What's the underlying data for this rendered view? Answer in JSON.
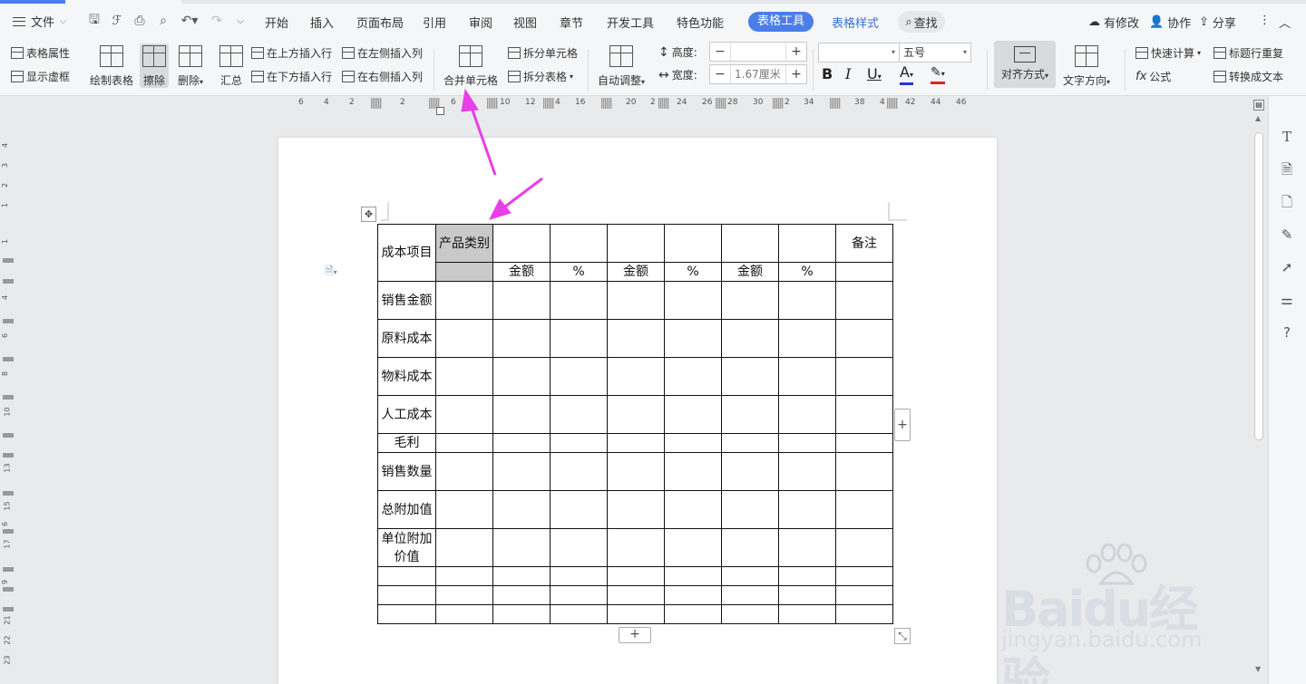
{
  "menubar": {
    "file_label": "文件",
    "items": [
      "开始",
      "插入",
      "页面布局",
      "引用",
      "审阅",
      "视图",
      "章节",
      "开发工具",
      "特色功能"
    ],
    "active_tab": "表格工具",
    "style_tab": "表格样式",
    "search_label": "查找",
    "right": {
      "modified": "有修改",
      "collab": "协作",
      "share": "分享"
    }
  },
  "ribbon": {
    "table_props": "表格属性",
    "show_grid": "显示虚框",
    "draw_table": "绘制表格",
    "erase": "擦除",
    "delete": "删除",
    "summary": "汇总",
    "insert_above": "在上方插入行",
    "insert_below": "在下方插入行",
    "insert_left": "在左侧插入列",
    "insert_right": "在右侧插入列",
    "merge_cells": "合并单元格",
    "split_cells": "拆分单元格",
    "split_table": "拆分表格",
    "auto_adjust": "自动调整",
    "height_label": "高度:",
    "height_value": "",
    "width_label": "宽度:",
    "width_value": "1.67厘米",
    "font_name": "",
    "font_size": "五号",
    "align": "对齐方式",
    "text_direction": "文字方向",
    "quick_calc": "快速计算",
    "formula": "公式",
    "repeat_header": "标题行重复",
    "to_text": "转换成文本"
  },
  "hruler_ticks": [
    "6",
    "4",
    "2",
    "2",
    "6",
    "10",
    "12",
    "4",
    "16",
    "20",
    "2",
    "24",
    "26",
    "28",
    "30",
    "2",
    "34",
    "38",
    "4",
    "42",
    "44",
    "46"
  ],
  "vruler_ticks": [
    "4",
    "3",
    "2",
    "1",
    "1",
    "4",
    "6",
    "8",
    "10",
    "13",
    "15",
    "6",
    "17",
    "9",
    "21",
    "22",
    "23"
  ],
  "table": {
    "r1": {
      "c0": "成本项目",
      "c1": "产品类别",
      "c8": "备注"
    },
    "r2": [
      "金额",
      "%",
      "金额",
      "%",
      "金额",
      "%"
    ],
    "rows": [
      "销售金额",
      "原料成本",
      "物料成本",
      "人工成本",
      "毛利",
      "销售数量",
      "总附加值",
      "单位附加价值",
      "",
      "",
      ""
    ]
  },
  "watermark": {
    "text1": "Baidu经验",
    "text2": "jingyan.baidu.com"
  },
  "colors": {
    "accent": "#4a7ee8",
    "arrow": "#e83fe8",
    "selection": "#c9c9c9"
  }
}
